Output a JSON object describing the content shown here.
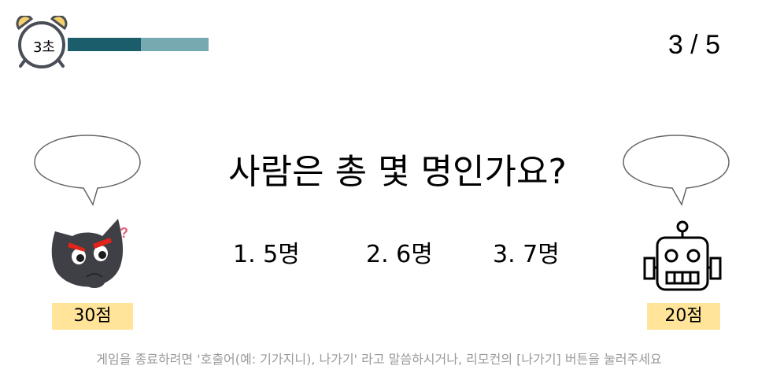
{
  "timer": {
    "label": "3초",
    "progress": 0.52
  },
  "counter": "3 / 5",
  "question": "사람은 총 몇 명인가요?",
  "options": [
    "1. 5명",
    "2. 6명",
    "3. 7명"
  ],
  "player": {
    "score": "30점",
    "avatar": "cat-icon",
    "bubble_text": ""
  },
  "ai": {
    "score": "20점",
    "avatar": "robot-icon",
    "bubble_text": ""
  },
  "hint": "게임을 종료하려면 '호출어(예: 기가지니), 나가기' 라고 말씀하시거나, 리모컨의 [나가기] 버튼을 눌러주세요",
  "colors": {
    "progress_fill": "#1b5d6a",
    "progress_track": "#77a9b0",
    "score_bg": "#ffe49a",
    "hint_text": "#9a9a9a"
  }
}
